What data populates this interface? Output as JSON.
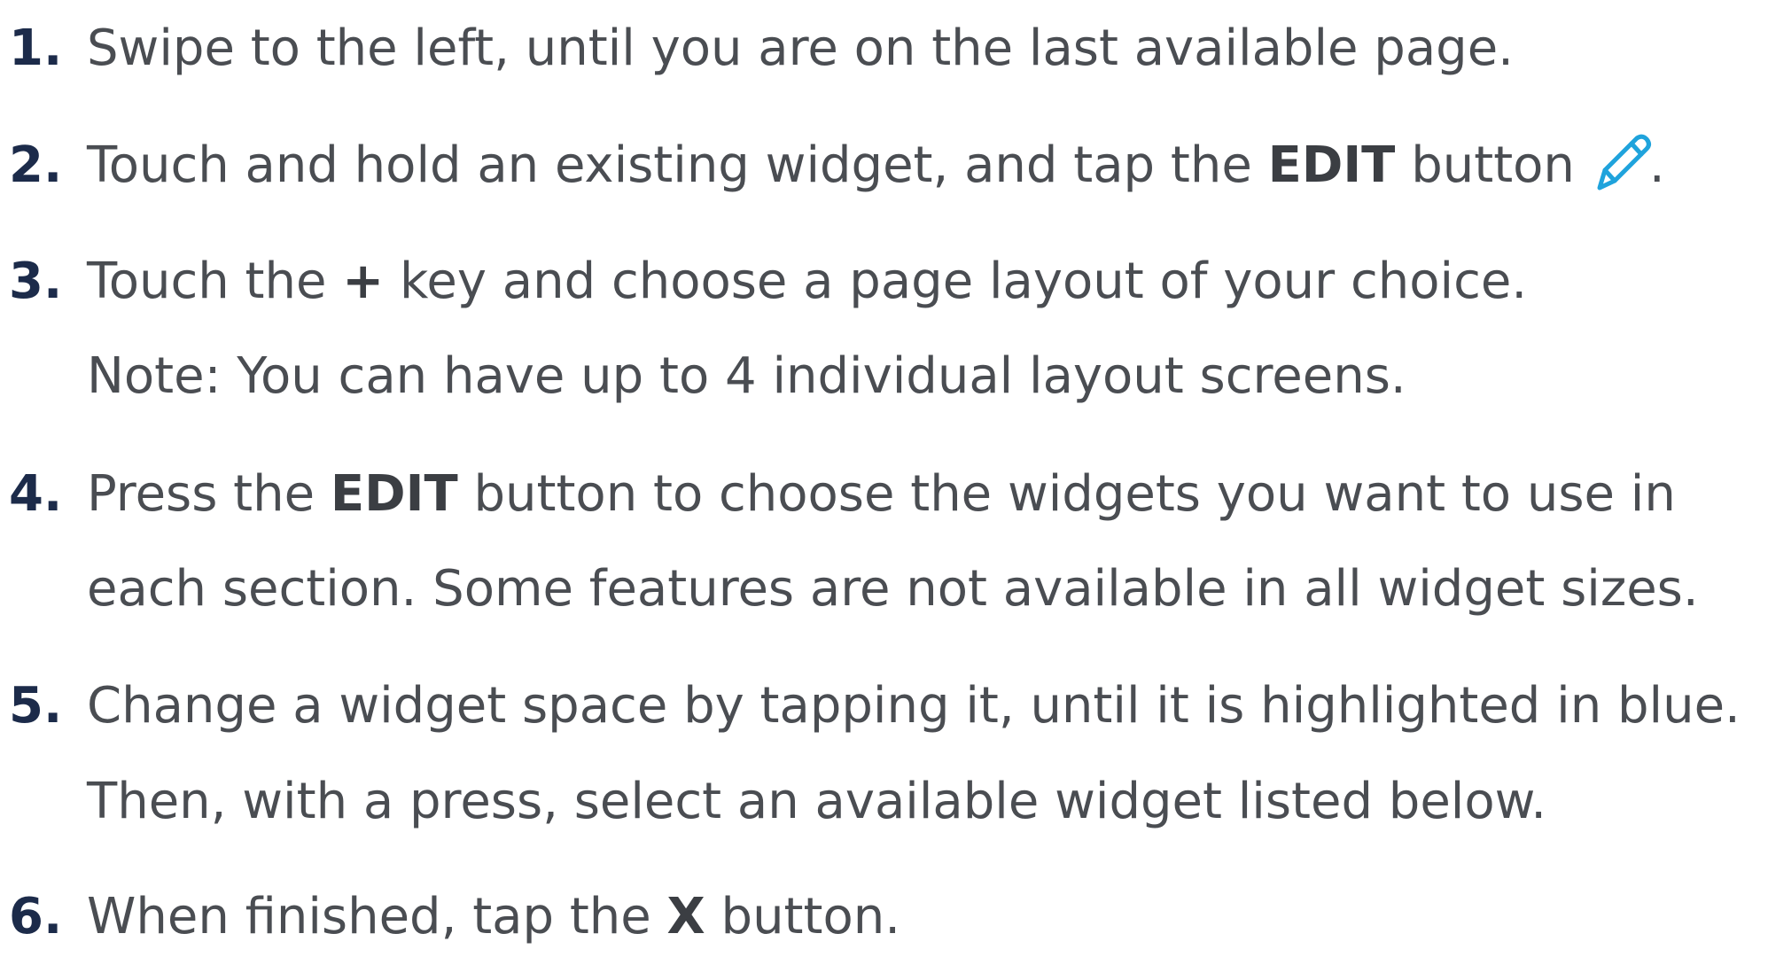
{
  "steps": [
    {
      "number": "1.",
      "line1": "Swipe to the left, until you are on the last available page."
    },
    {
      "number": "2.",
      "pre": "Touch and hold an existing widget, and tap the ",
      "bold": "EDIT",
      "post": " button",
      "icon": "pencil-icon",
      "icon_color": "#1fa3dc",
      "end": "."
    },
    {
      "number": "3.",
      "pre": "Touch the ",
      "bold": "+",
      "post": " key and choose a page layout of your choice.",
      "line2": "Note: You can have up to 4 individual layout screens."
    },
    {
      "number": "4.",
      "pre": "Press the ",
      "bold": "EDIT",
      "post": " button to choose the widgets you want to use in",
      "line2": "each section. Some features are not available in all widget sizes."
    },
    {
      "number": "5.",
      "line1": "Change a widget space by tapping it, until it is highlighted in blue.",
      "line2": "Then, with a press, select an available widget listed below."
    },
    {
      "number": "6.",
      "pre": "When finished, tap the ",
      "bold": "X",
      "post": " button."
    }
  ]
}
